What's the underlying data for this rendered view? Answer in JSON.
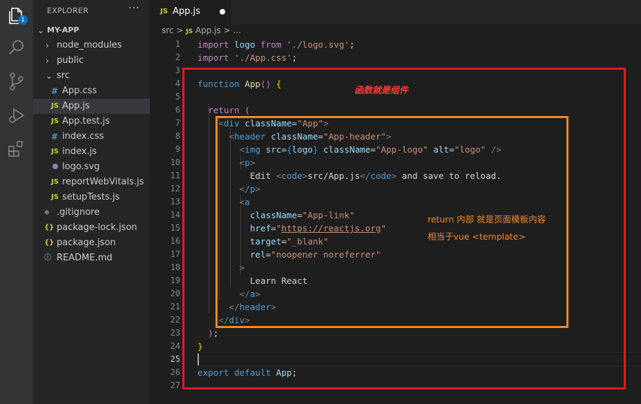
{
  "explorer": {
    "title": "EXPLORER",
    "more": "···",
    "project": "MY-APP",
    "badge": "1",
    "items": [
      {
        "label": "node_modules",
        "type": "folder",
        "collapsed": true
      },
      {
        "label": "public",
        "type": "folder",
        "collapsed": true
      },
      {
        "label": "src",
        "type": "folder",
        "collapsed": false
      },
      {
        "label": "App.css",
        "type": "css",
        "icon": "#"
      },
      {
        "label": "App.js",
        "type": "js",
        "icon": "JS",
        "selected": true
      },
      {
        "label": "App.test.js",
        "type": "js",
        "icon": "JS"
      },
      {
        "label": "index.css",
        "type": "css",
        "icon": "#"
      },
      {
        "label": "index.js",
        "type": "js",
        "icon": "JS"
      },
      {
        "label": "logo.svg",
        "type": "svg",
        "icon": "svg-icon"
      },
      {
        "label": "reportWebVitals.js",
        "type": "js",
        "icon": "JS"
      },
      {
        "label": "setupTests.js",
        "type": "js",
        "icon": "JS"
      },
      {
        "label": ".gitignore",
        "type": "git",
        "icon": "◆"
      },
      {
        "label": "package-lock.json",
        "type": "json",
        "icon": "{}"
      },
      {
        "label": "package.json",
        "type": "json",
        "icon": "{}"
      },
      {
        "label": "README.md",
        "type": "md",
        "icon": "ⓘ"
      }
    ]
  },
  "tab": {
    "js_badge": "JS",
    "name": "App.js"
  },
  "breadcrumb": {
    "folder": "src",
    "sep": ">",
    "js_badge": "JS",
    "file": "App.js",
    "tail": "> ..."
  },
  "editor": {
    "lines": [
      [
        [
          "kw2",
          "import "
        ],
        [
          "var",
          "logo "
        ],
        [
          "kw2",
          "from "
        ],
        [
          "str",
          "'./logo.svg'"
        ],
        [
          "plain",
          ";"
        ]
      ],
      [
        [
          "kw2",
          "import "
        ],
        [
          "str",
          "'./App.css'"
        ],
        [
          "plain",
          ";"
        ]
      ],
      [],
      [
        [
          "kw",
          "function "
        ],
        [
          "fn",
          "App"
        ],
        [
          "paren",
          "()"
        ],
        [
          "plain",
          " "
        ],
        [
          "brace",
          "{"
        ]
      ],
      [],
      [
        [
          "plain",
          "  "
        ],
        [
          "kw2",
          "return "
        ],
        [
          "paren",
          "("
        ]
      ],
      [
        [
          "plain",
          "    "
        ],
        [
          "punc",
          "<"
        ],
        [
          "tag",
          "div "
        ],
        [
          "attr",
          "className"
        ],
        [
          "plain",
          "="
        ],
        [
          "str",
          "\"App\""
        ],
        [
          "punc",
          ">"
        ]
      ],
      [
        [
          "plain",
          "      "
        ],
        [
          "punc",
          "<"
        ],
        [
          "tag",
          "header "
        ],
        [
          "attr",
          "className"
        ],
        [
          "plain",
          "="
        ],
        [
          "str",
          "\"App-header\""
        ],
        [
          "punc",
          ">"
        ]
      ],
      [
        [
          "plain",
          "        "
        ],
        [
          "punc",
          "<"
        ],
        [
          "tag",
          "img "
        ],
        [
          "attr",
          "src"
        ],
        [
          "plain",
          "="
        ],
        [
          "brace3",
          "{"
        ],
        [
          "var",
          "logo"
        ],
        [
          "brace3",
          "}"
        ],
        [
          "plain",
          " "
        ],
        [
          "attr",
          "className"
        ],
        [
          "plain",
          "="
        ],
        [
          "str",
          "\"App-logo\""
        ],
        [
          "plain",
          " "
        ],
        [
          "attr",
          "alt"
        ],
        [
          "plain",
          "="
        ],
        [
          "str",
          "\"logo\""
        ],
        [
          "plain",
          " "
        ],
        [
          "punc",
          "/>"
        ]
      ],
      [
        [
          "plain",
          "        "
        ],
        [
          "punc",
          "<"
        ],
        [
          "tag",
          "p"
        ],
        [
          "punc",
          ">"
        ]
      ],
      [
        [
          "plain",
          "          Edit "
        ],
        [
          "punc",
          "<"
        ],
        [
          "tag",
          "code"
        ],
        [
          "punc",
          ">"
        ],
        [
          "plain",
          "src/App.js"
        ],
        [
          "punc",
          "</"
        ],
        [
          "tag",
          "code"
        ],
        [
          "punc",
          ">"
        ],
        [
          "plain",
          " and save to reload."
        ]
      ],
      [
        [
          "plain",
          "        "
        ],
        [
          "punc",
          "</"
        ],
        [
          "tag",
          "p"
        ],
        [
          "punc",
          ">"
        ]
      ],
      [
        [
          "plain",
          "        "
        ],
        [
          "punc",
          "<"
        ],
        [
          "tag",
          "a"
        ]
      ],
      [
        [
          "plain",
          "          "
        ],
        [
          "attr",
          "className"
        ],
        [
          "plain",
          "="
        ],
        [
          "str",
          "\"App-link\""
        ]
      ],
      [
        [
          "plain",
          "          "
        ],
        [
          "attr",
          "href"
        ],
        [
          "plain",
          "="
        ],
        [
          "str",
          "\""
        ],
        [
          "strlink",
          "https://reactjs.org"
        ],
        [
          "str",
          "\""
        ]
      ],
      [
        [
          "plain",
          "          "
        ],
        [
          "attr",
          "target"
        ],
        [
          "plain",
          "="
        ],
        [
          "str",
          "\"_blank\""
        ]
      ],
      [
        [
          "plain",
          "          "
        ],
        [
          "attr",
          "rel"
        ],
        [
          "plain",
          "="
        ],
        [
          "str",
          "\"noopener noreferrer\""
        ]
      ],
      [
        [
          "plain",
          "        "
        ],
        [
          "punc",
          ">"
        ]
      ],
      [
        [
          "plain",
          "          Learn React"
        ]
      ],
      [
        [
          "plain",
          "        "
        ],
        [
          "punc",
          "</"
        ],
        [
          "tag",
          "a"
        ],
        [
          "punc",
          ">"
        ]
      ],
      [
        [
          "plain",
          "      "
        ],
        [
          "punc",
          "</"
        ],
        [
          "tag",
          "header"
        ],
        [
          "punc",
          ">"
        ]
      ],
      [
        [
          "plain",
          "    "
        ],
        [
          "punc",
          "</"
        ],
        [
          "tag",
          "div"
        ],
        [
          "punc",
          ">"
        ]
      ],
      [
        [
          "plain",
          "  "
        ],
        [
          "paren",
          ")"
        ],
        [
          "plain",
          ";"
        ]
      ],
      [
        [
          "brace",
          "}"
        ]
      ],
      [],
      [
        [
          "kw",
          "export "
        ],
        [
          "kw",
          "default "
        ],
        [
          "var",
          "App"
        ],
        [
          "plain",
          ";"
        ]
      ],
      []
    ],
    "active_line": 25
  },
  "annotations": {
    "red_note": "函数就是组件",
    "orange_note_1": "return 内部 就是页面模板内容",
    "orange_note_2": "相当于vue <template>",
    "red_color": "#e8181e",
    "orange_color": "#f28a2a"
  }
}
